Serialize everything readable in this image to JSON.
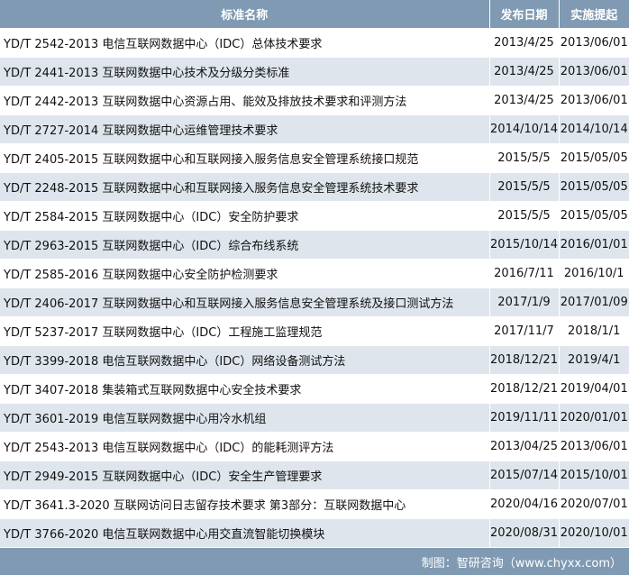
{
  "table": {
    "headers": [
      "标准名称",
      "发布日期",
      "实施提起"
    ],
    "rows": [
      {
        "name": "YD/T 2542-2013 电信互联网数据中心（IDC）总体技术要求",
        "published": "2013/4/25",
        "effective": "2013/06/01"
      },
      {
        "name": "YD/T 2441-2013 互联网数据中心技术及分级分类标准",
        "published": "2013/4/25",
        "effective": "2013/06/01"
      },
      {
        "name": "YD/T 2442-2013 互联网数据中心资源占用、能效及排放技术要求和评测方法",
        "published": "2013/4/25",
        "effective": "2013/06/01"
      },
      {
        "name": "YD/T 2727-2014 互联网数据中心运维管理技术要求",
        "published": "2014/10/14",
        "effective": "2014/10/14"
      },
      {
        "name": "YD/T 2405-2015 互联网数据中心和互联网接入服务信息安全管理系统接口规范",
        "published": "2015/5/5",
        "effective": "2015/05/05"
      },
      {
        "name": "YD/T 2248-2015 互联网数据中心和互联网接入服务信息安全管理系统技术要求",
        "published": "2015/5/5",
        "effective": "2015/05/05"
      },
      {
        "name": "YD/T 2584-2015 互联网数据中心（IDC）安全防护要求",
        "published": "2015/5/5",
        "effective": "2015/05/05"
      },
      {
        "name": "YD/T 2963-2015 互联网数据中心（IDC）综合布线系统",
        "published": "2015/10/14",
        "effective": "2016/01/01"
      },
      {
        "name": "YD/T 2585-2016 互联网数据中心安全防护检测要求",
        "published": "2016/7/11",
        "effective": "2016/10/1"
      },
      {
        "name": "YD/T 2406-2017 互联网数据中心和互联网接入服务信息安全管理系统及接口测试方法",
        "published": "2017/1/9",
        "effective": "2017/01/09"
      },
      {
        "name": "YD/T 5237-2017 互联网数据中心（IDC）工程施工监理规范",
        "published": "2017/11/7",
        "effective": "2018/1/1"
      },
      {
        "name": "YD/T 3399-2018 电信互联网数据中心（IDC）网络设备测试方法",
        "published": "2018/12/21",
        "effective": "2019/4/1"
      },
      {
        "name": "YD/T 3407-2018 集装箱式互联网数据中心安全技术要求",
        "published": "2018/12/21",
        "effective": "2019/04/01"
      },
      {
        "name": "YD/T 3601-2019 电信互联网数据中心用冷水机组",
        "published": "2019/11/11",
        "effective": "2020/01/01"
      },
      {
        "name": "YD/T 2543-2013 电信互联网数据中心（IDC）的能耗测评方法",
        "published": "2013/04/25",
        "effective": "2013/06/01"
      },
      {
        "name": "YD/T 2949-2015 互联网数据中心（IDC）安全生产管理要求",
        "published": "2015/07/14",
        "effective": "2015/10/01"
      },
      {
        "name": "YD/T 3641.3-2020 互联网访问日志留存技术要求 第3部分：互联网数据中心",
        "published": "2020/04/16",
        "effective": "2020/07/01"
      },
      {
        "name": "YD/T 3766-2020 电信互联网数据中心用交直流智能切换模块",
        "published": "2020/08/31",
        "effective": "2020/10/01"
      }
    ]
  },
  "footer": {
    "source": "制图：智研咨询（www.chyxx.com）"
  },
  "colors": {
    "header_bg": "#7f9ab2",
    "stripe": "#dee5ec"
  }
}
